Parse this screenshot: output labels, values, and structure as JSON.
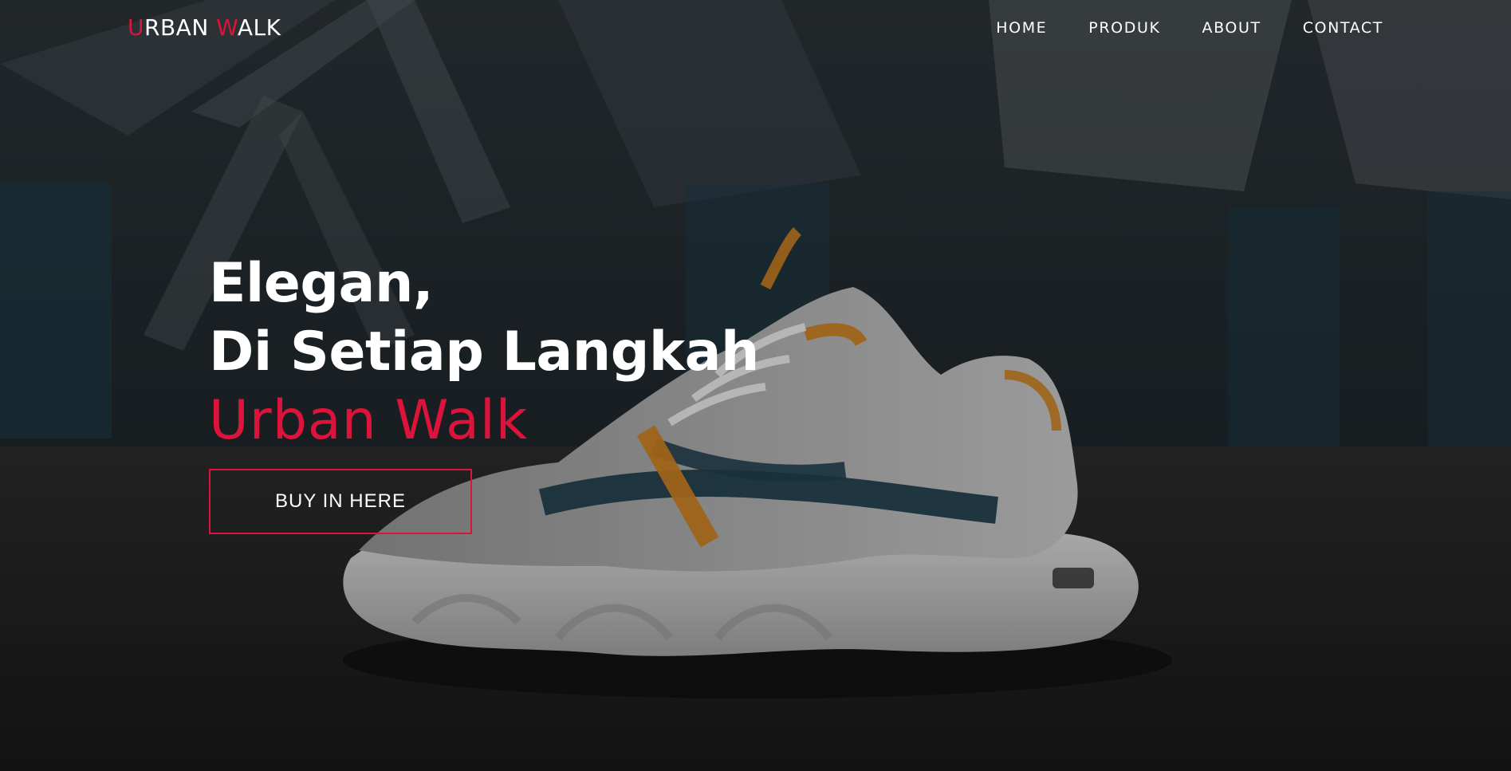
{
  "brand": {
    "logo_first_initial": "U",
    "logo_first_rest": "RBAN ",
    "logo_second_initial": "W",
    "logo_second_rest": "ALK",
    "accent_color": "#dc143c"
  },
  "nav": {
    "items": [
      {
        "label": "HOME"
      },
      {
        "label": "PRODUK"
      },
      {
        "label": "ABOUT"
      },
      {
        "label": "CONTACT"
      }
    ]
  },
  "hero": {
    "line1": "Elegan,",
    "line2": "Di Setiap Langkah",
    "brand_line": "Urban Walk",
    "cta_label": "BUY IN HERE"
  }
}
